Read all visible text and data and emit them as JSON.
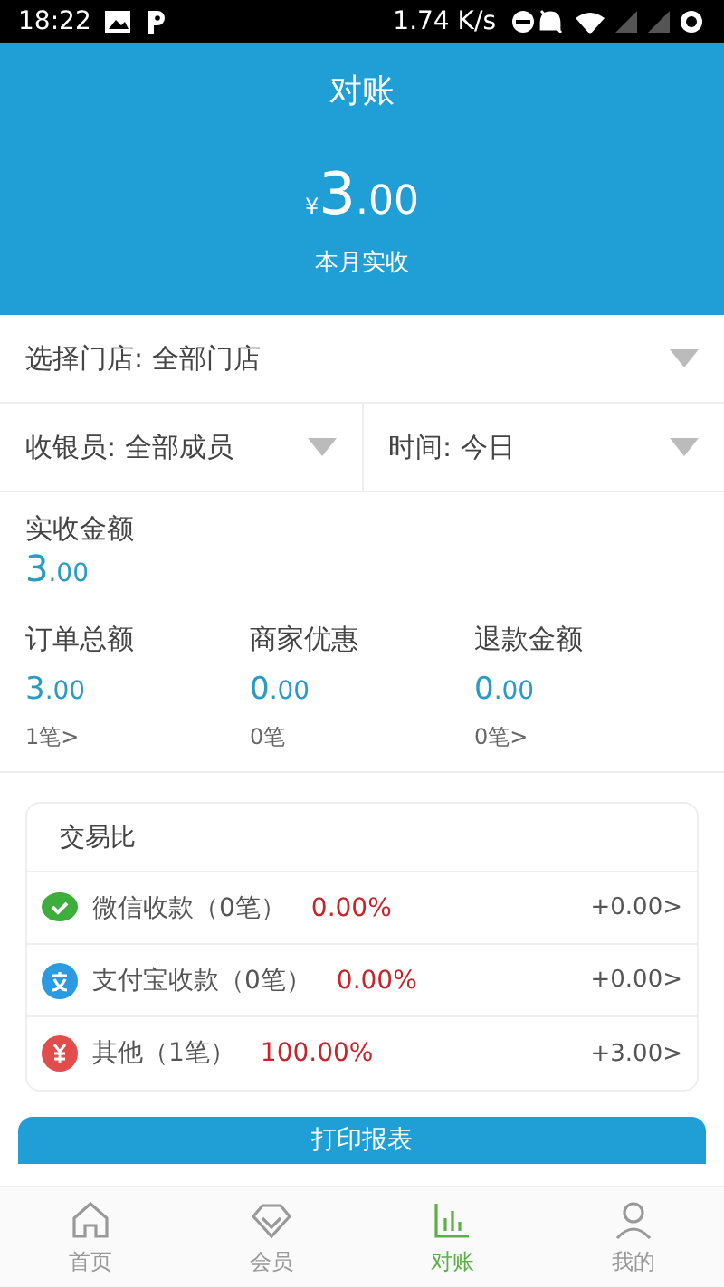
{
  "status_bar": {
    "time": "18:22",
    "speed": "1.74 K/s"
  },
  "header": {
    "title": "对账",
    "currency": "¥",
    "amount_int": "3",
    "amount_dec": ".00",
    "caption": "本月实收"
  },
  "filters": {
    "store": {
      "label": "选择门店:",
      "value": "全部门店"
    },
    "cashier": {
      "label": "收银员:",
      "value": "全部成员"
    },
    "time": {
      "label": "时间:",
      "value": "今日"
    }
  },
  "received": {
    "label": "实收金额",
    "int": "3",
    "dec": ".00"
  },
  "stats": [
    {
      "label": "订单总额",
      "int": "3",
      "dec": ".00",
      "count": "1笔>"
    },
    {
      "label": "商家优惠",
      "int": "0",
      "dec": ".00",
      "count": "0笔"
    },
    {
      "label": "退款金额",
      "int": "0",
      "dec": ".00",
      "count": "0笔>"
    }
  ],
  "ratio": {
    "title": "交易比",
    "rows": [
      {
        "kind": "wechat",
        "label": "微信收款（0笔）",
        "percent": "0.00%",
        "amount": "+0.00>"
      },
      {
        "kind": "alipay",
        "label": "支付宝收款（0笔）",
        "percent": "0.00%",
        "amount": "+0.00>"
      },
      {
        "kind": "other",
        "label": "其他（1笔）",
        "percent": "100.00%",
        "amount": "+3.00>"
      }
    ]
  },
  "print_button": "打印报表",
  "tabs": [
    {
      "kind": "home",
      "label": "首页",
      "selected": false
    },
    {
      "kind": "member",
      "label": "会员",
      "selected": false
    },
    {
      "kind": "reconcile",
      "label": "对账",
      "selected": true
    },
    {
      "kind": "me",
      "label": "我的",
      "selected": false
    }
  ]
}
